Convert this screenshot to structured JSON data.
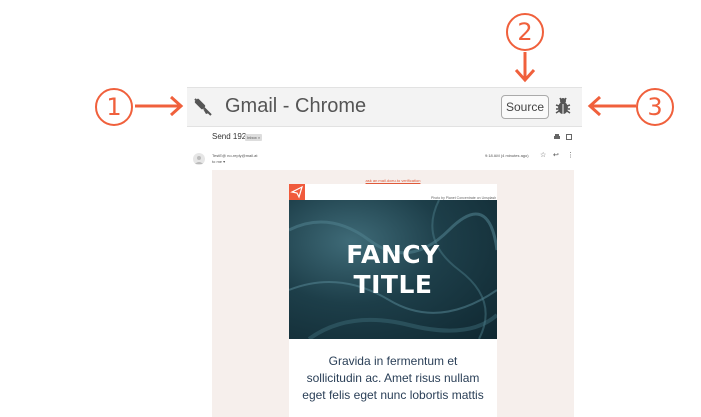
{
  "callouts": [
    "1",
    "2",
    "3"
  ],
  "colors": {
    "accent": "#f0603c",
    "header_bg": "#f3f3f3",
    "email_bg": "#f6efec",
    "hero_dark": "#1d3e49"
  },
  "window": {
    "title": "Gmail - Chrome",
    "left_icon": "tools-off-icon",
    "source_label": "Source",
    "right_icon": "bug-icon"
  },
  "gmail": {
    "subject": "Send 192",
    "inbox_badge": "Inbox ×",
    "sender": "TestE@ no-reply@mail.at",
    "to": "to me ▾",
    "time": "9:18 AM (4 minutes ago)"
  },
  "email": {
    "view_link": "ask an mail.doeu.to verification",
    "photo_credit": "Photo by Planet Concentrate on Unsplash",
    "hero_title": "FANCY\nTITLE",
    "body_lines": [
      "Gravida in fermentum et",
      "sollicitudin ac. Amet risus nullam",
      "eget felis eget nunc lobortis mattis"
    ]
  }
}
